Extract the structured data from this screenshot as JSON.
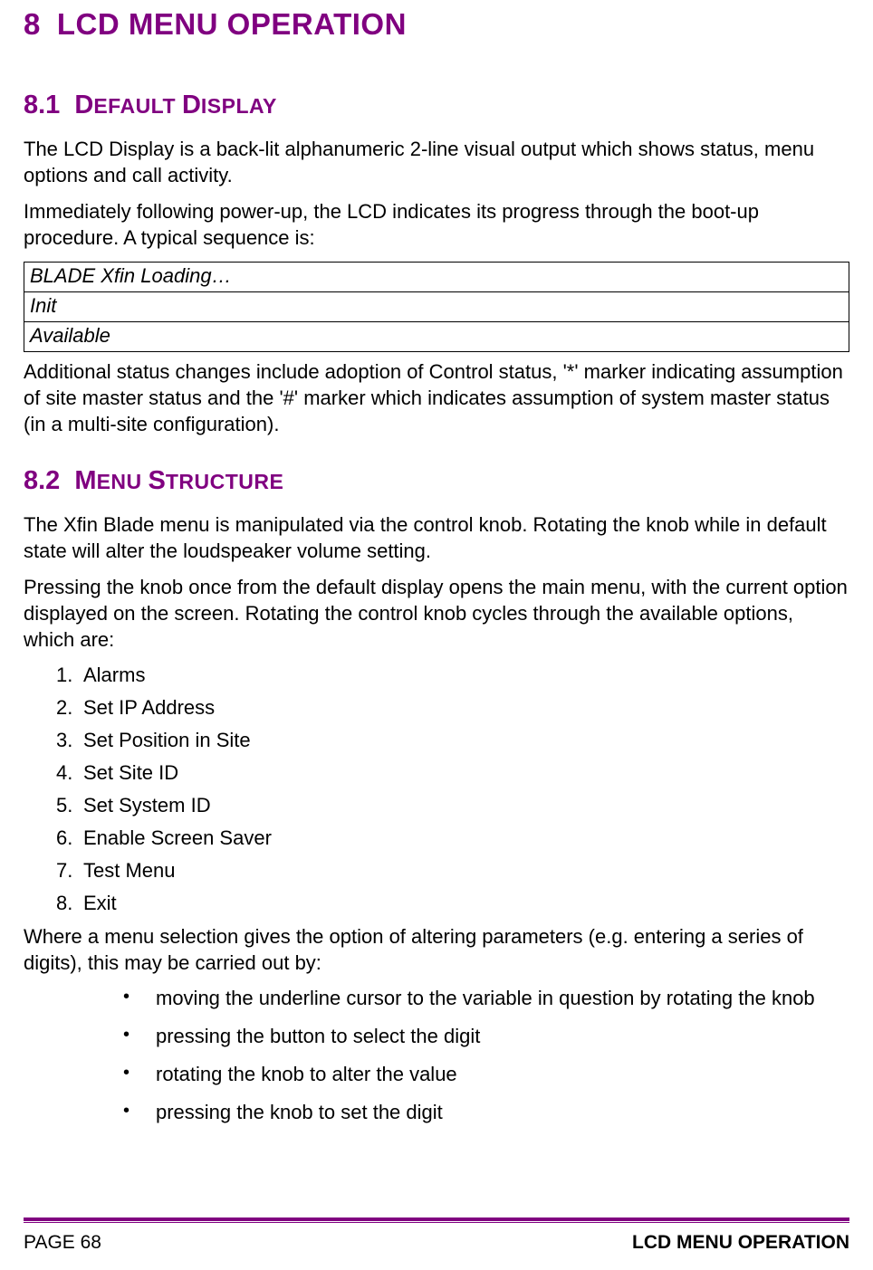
{
  "h1": {
    "num": "8",
    "text": "LCD MENU OPERATION"
  },
  "s81": {
    "num": "8.1",
    "lead": "D",
    "rest1": "EFAULT ",
    "lead2": "D",
    "rest2": "ISPLAY",
    "p1": "The LCD Display is a back-lit alphanumeric 2-line visual output which shows status, menu options and call activity.",
    "p2": "Immediately following power-up, the LCD indicates its progress through the boot-up procedure. A typical sequence is:",
    "seq": [
      "BLADE Xfin Loading…",
      "Init",
      "Available"
    ],
    "p3": "Additional status changes include adoption of Control status, '*' marker indicating assumption of site master status and the '#' marker which indicates assumption of system master status (in a multi-site configuration)."
  },
  "s82": {
    "num": "8.2",
    "lead": "M",
    "rest1": "ENU ",
    "lead2": "S",
    "rest2": "TRUCTURE",
    "p1": "The Xfin Blade menu is manipulated via the control knob. Rotating the knob while in default state will alter the loudspeaker volume setting.",
    "p2": "Pressing the knob once from the default display opens the main menu, with the current option displayed on the screen. Rotating the control knob cycles through the available options, which are:",
    "options": [
      "Alarms",
      "Set IP Address",
      "Set Position in Site",
      "Set Site ID",
      "Set System ID",
      "Enable Screen Saver",
      "Test Menu",
      "Exit"
    ],
    "p3": "Where a menu selection gives the option of altering parameters (e.g. entering a series of digits), this may be carried out by:",
    "bullets": [
      "moving the underline cursor to the variable in question by rotating the knob",
      "pressing the button to select the digit",
      "rotating the knob to alter the value",
      "pressing the knob to set the digit"
    ]
  },
  "footer": {
    "left": "PAGE 68",
    "right": "LCD MENU OPERATION"
  }
}
